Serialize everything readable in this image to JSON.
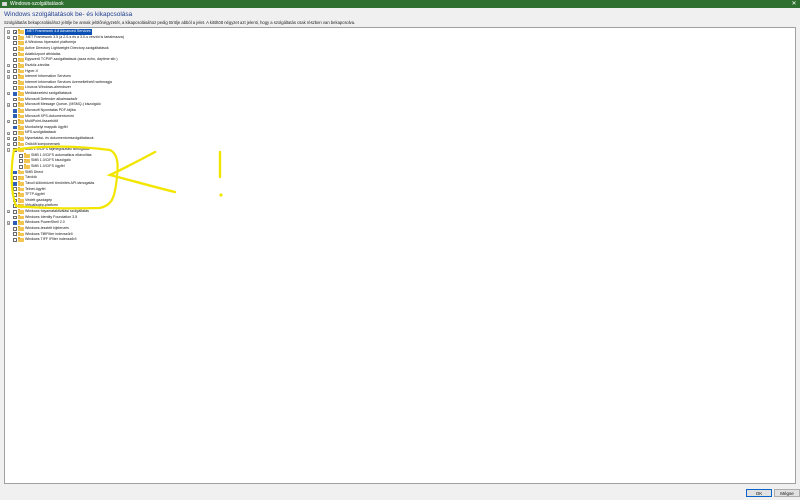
{
  "window": {
    "title": "Windows-szolgáltatások",
    "close_glyph": "✕"
  },
  "header": {
    "title": "Windows szolgáltatások be- és kikapcsolása",
    "description": "Szolgáltatás bekapcsolásához jelölje be annak jelölőnégyzetét, a kikapcsolásához pedig törölje abból a jelet. A kitöltött négyzet azt jelenti, hogy a szolgáltatás csak részben van bekapcsolva."
  },
  "tree": [
    {
      "label": ".NET Framework 4.8 Advanced Services",
      "expander": "+",
      "check": "partial",
      "level": 0,
      "selected": true
    },
    {
      "label": ".NET Framework 3.5 (a 2.0-s és a 3.0-s verziót is tartalmazza)",
      "expander": "+",
      "check": "none",
      "level": 0
    },
    {
      "label": "A Windows hiperszint platformja",
      "expander": "",
      "check": "none",
      "level": 0
    },
    {
      "label": "Active Directory Lightweight Directory-szolgáltatások",
      "expander": "",
      "check": "none",
      "level": 0
    },
    {
      "label": "Adatközpont áthidalás",
      "expander": "",
      "check": "none",
      "level": 0
    },
    {
      "label": "Egyszerű TCP/IP-szolgáltatások (azaz echo, daytime stb.)",
      "expander": "",
      "check": "none",
      "level": 0
    },
    {
      "label": "Eszköz-zárolás",
      "expander": "+",
      "check": "none",
      "level": 0
    },
    {
      "label": "Hyper-V",
      "expander": "+",
      "check": "none",
      "level": 0
    },
    {
      "label": "Internet Information Services",
      "expander": "+",
      "check": "none",
      "level": 0
    },
    {
      "label": "Internet Information Services üzemeltethető webmagja",
      "expander": "",
      "check": "none",
      "level": 0
    },
    {
      "label": "Linuxos Windows-alrendszer",
      "expander": "",
      "check": "none",
      "level": 0
    },
    {
      "label": "Médiakezelési szolgáltatások",
      "expander": "+",
      "check": "checked",
      "level": 0
    },
    {
      "label": "Microsoft Defender alkalmazásőr",
      "expander": "",
      "check": "none",
      "level": 0
    },
    {
      "label": "Microsoft Message Queue- (MSMQ-) kiszolgáló",
      "expander": "+",
      "check": "none",
      "level": 0
    },
    {
      "label": "Microsoft Nyomtatás PDF-fájlba",
      "expander": "",
      "check": "checked",
      "level": 0
    },
    {
      "label": "Microsoft XPS-dokumentumíró",
      "expander": "",
      "check": "checked",
      "level": 0
    },
    {
      "label": "MultiPoint-összekötő",
      "expander": "+",
      "check": "none",
      "level": 0
    },
    {
      "label": "Munkahelyi mappák ügyfél",
      "expander": "",
      "check": "checked",
      "level": 0
    },
    {
      "label": "NFS-szolgáltatások",
      "expander": "+",
      "check": "none",
      "level": 0
    },
    {
      "label": "Nyomtatási- és dokumentumszolgáltatások",
      "expander": "+",
      "check": "partial",
      "level": 0
    },
    {
      "label": "Örökölt komponensek",
      "expander": "+",
      "check": "none",
      "level": 0
    },
    {
      "label": "SMB 1.0/CIFS fájlmegosztási támogatás",
      "expander": "−",
      "check": "none",
      "level": 0
    },
    {
      "label": "SMB 1.0/CIFS automatikus eltávolítás",
      "expander": "",
      "check": "none",
      "level": 1
    },
    {
      "label": "SMB 1.0/CIFS kiszolgáló",
      "expander": "",
      "check": "none",
      "level": 1
    },
    {
      "label": "SMB 1.0/CIFS ügyfél",
      "expander": "",
      "check": "none",
      "level": 1
    },
    {
      "label": "SMB Direct",
      "expander": "",
      "check": "checked",
      "level": 0
    },
    {
      "label": "Tárolók",
      "expander": "",
      "check": "none",
      "level": 0
    },
    {
      "label": "Távoli különbözeti tömörítés API-támogatás",
      "expander": "",
      "check": "checked",
      "level": 0
    },
    {
      "label": "Telnet-ügyfél",
      "expander": "",
      "check": "none",
      "level": 0
    },
    {
      "label": "TFTP-ügyfél",
      "expander": "",
      "check": "none",
      "level": 0
    },
    {
      "label": "Védett gazdagép",
      "expander": "",
      "check": "none",
      "level": 0
    },
    {
      "label": "Virtuálisgép-platform",
      "expander": "",
      "check": "none",
      "level": 0
    },
    {
      "label": "Windows folyamataktiválási szolgáltatás",
      "expander": "+",
      "check": "none",
      "level": 0
    },
    {
      "label": "Windows Identity Foundation 3.5",
      "expander": "",
      "check": "none",
      "level": 0
    },
    {
      "label": "Windows PowerShell 2.0",
      "expander": "+",
      "check": "checked",
      "level": 0
    },
    {
      "label": "Windows-tesztelt kijelenzés",
      "expander": "",
      "check": "none",
      "level": 0
    },
    {
      "label": "Windows TiffIFilter indexszűrő",
      "expander": "",
      "check": "none",
      "level": 0
    },
    {
      "label": "Windows TIFF IFilter indexszűrő",
      "expander": "",
      "check": "none",
      "level": 0
    }
  ],
  "footer": {
    "ok_label": "OK",
    "cancel_label": "Mégse"
  },
  "colors": {
    "titlebar": "#2f6f30",
    "accent": "#2b5fb8",
    "folder": "#f3c652",
    "annotation": "#f2e600"
  }
}
